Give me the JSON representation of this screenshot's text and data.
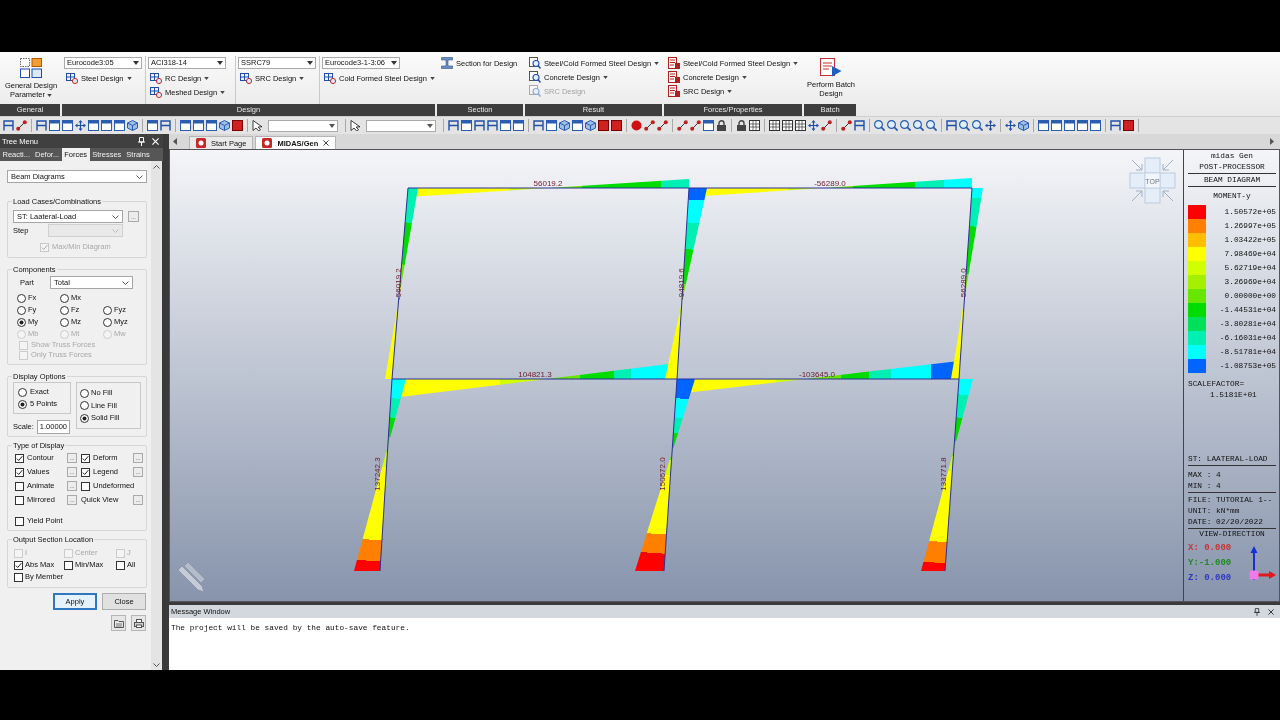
{
  "ribbon": {
    "groups": [
      {
        "label": "General",
        "columns": [
          [
            {
              "kind": "large",
              "label": "General Design Parameter",
              "menu": true,
              "disabled": false
            }
          ]
        ]
      },
      {
        "label": "Design",
        "columns": [
          [
            {
              "kind": "select",
              "label": "Eurocode3:05"
            },
            {
              "kind": "button",
              "label": "Steel Design",
              "menu": true,
              "disabled": false
            }
          ],
          [
            {
              "kind": "select",
              "label": "ACI318-14"
            },
            {
              "kind": "button",
              "label": "RC Design",
              "menu": true,
              "disabled": false
            },
            {
              "kind": "button",
              "label": "Meshed Design",
              "menu": true,
              "disabled": false
            }
          ],
          [
            {
              "kind": "select",
              "label": "SSRC79"
            },
            {
              "kind": "button",
              "label": "SRC Design",
              "menu": true,
              "disabled": false
            }
          ],
          [
            {
              "kind": "select",
              "label": "Eurocode3-1-3:06"
            },
            {
              "kind": "button",
              "label": "Cold Formed Steel Design",
              "menu": true,
              "disabled": false
            }
          ]
        ]
      },
      {
        "label": "Section",
        "columns": [
          [
            {
              "kind": "button",
              "label": "Section for Design",
              "menu": false,
              "disabled": false
            }
          ]
        ]
      },
      {
        "label": "Result",
        "columns": [
          [
            {
              "kind": "button",
              "label": "Steel/Cold Formed Steel Design",
              "menu": true,
              "disabled": false
            },
            {
              "kind": "button",
              "label": "Concrete Design",
              "menu": true,
              "disabled": false
            },
            {
              "kind": "button",
              "label": "SRC Design",
              "menu": false,
              "disabled": true
            }
          ]
        ]
      },
      {
        "label": "Forces/Properties",
        "columns": [
          [
            {
              "kind": "button",
              "label": "Steel/Cold Formed Steel Design",
              "menu": true,
              "disabled": false
            },
            {
              "kind": "button",
              "label": "Concrete Design",
              "menu": true,
              "disabled": false
            },
            {
              "kind": "button",
              "label": "SRC Design",
              "menu": true,
              "disabled": false
            }
          ]
        ]
      },
      {
        "label": "Batch",
        "columns": [
          [
            {
              "kind": "large",
              "label": "Perform Batch Design",
              "menu": false,
              "disabled": false
            }
          ]
        ]
      }
    ]
  },
  "tree_menu": {
    "title": "Tree Menu",
    "tabs": [
      {
        "label": "Reacti...",
        "selected": false
      },
      {
        "label": "Defor...",
        "selected": false
      },
      {
        "label": "Forces",
        "selected": true
      },
      {
        "label": "Stresses",
        "selected": false
      },
      {
        "label": "Strains",
        "selected": false
      }
    ],
    "diagram_type": "Beam Diagrams",
    "load_cases": {
      "title": "Load Cases/Combinations",
      "value": "ST: Laateral-Load",
      "more_button": "...",
      "step_label": "Step",
      "max_min": {
        "label": "Max/Min Diagram",
        "checked": true,
        "disabled": true
      }
    },
    "components": {
      "title": "Components",
      "part_label": "Part",
      "part": "Total",
      "rows": [
        [
          {
            "label": "Fx",
            "selected": false,
            "disabled": false
          },
          {
            "label": "Mx",
            "selected": false,
            "disabled": false
          }
        ],
        [
          {
            "label": "Fy",
            "selected": false,
            "disabled": false
          },
          {
            "label": "Fz",
            "selected": false,
            "disabled": false
          },
          {
            "label": "Fyz",
            "selected": false,
            "disabled": false
          }
        ],
        [
          {
            "label": "My",
            "selected": true,
            "disabled": false
          },
          {
            "label": "Mz",
            "selected": false,
            "disabled": false
          },
          {
            "label": "Myz",
            "selected": false,
            "disabled": false
          }
        ],
        [
          {
            "label": "Mb",
            "selected": false,
            "disabled": true
          },
          {
            "label": "Mt",
            "selected": false,
            "disabled": true
          },
          {
            "label": "Mw",
            "selected": false,
            "disabled": true
          }
        ]
      ],
      "checks": [
        {
          "label": "Show Truss Forces",
          "checked": false,
          "disabled": true
        },
        {
          "label": "Only Truss Forces",
          "checked": false,
          "disabled": true
        }
      ]
    },
    "display_options": {
      "title": "Display Options",
      "points": [
        {
          "label": "Exact",
          "selected": false
        },
        {
          "label": "5 Points",
          "selected": true
        }
      ],
      "fill": [
        {
          "label": "No Fill",
          "selected": false
        },
        {
          "label": "Line Fill",
          "selected": false
        },
        {
          "label": "Solid Fill",
          "selected": true
        }
      ],
      "scale_label": "Scale:",
      "scale": "1.00000"
    },
    "type_of_display": {
      "title": "Type of Display",
      "items": [
        {
          "kind": "check",
          "label": "Contour",
          "checked": true,
          "button": "..."
        },
        {
          "kind": "check",
          "label": "Deform",
          "checked": true,
          "button": "..."
        },
        {
          "kind": "check",
          "label": "Values",
          "checked": true,
          "button": "..."
        },
        {
          "kind": "check",
          "label": "Legend",
          "checked": true,
          "button": "..."
        },
        {
          "kind": "check",
          "label": "Animate",
          "checked": false,
          "button": "..."
        },
        {
          "kind": "check",
          "label": "Undeformed",
          "checked": false
        },
        {
          "kind": "check",
          "label": "Mirrored",
          "checked": false,
          "button": "..."
        },
        {
          "kind": "text",
          "label": "Quick View",
          "button": "..."
        }
      ],
      "yield_point": {
        "label": "Yield Point",
        "checked": false
      }
    },
    "output_location": {
      "title": "Output Section Location",
      "rows": [
        [
          {
            "label": "I",
            "checked": false,
            "disabled": true
          },
          {
            "label": "Center",
            "checked": false,
            "disabled": true
          },
          {
            "label": "J",
            "checked": false,
            "disabled": true
          }
        ],
        [
          {
            "label": "Abs Max",
            "checked": true,
            "disabled": false
          },
          {
            "label": "Min/Max",
            "checked": false,
            "disabled": false
          },
          {
            "label": "All",
            "checked": false,
            "disabled": false
          }
        ],
        [
          {
            "label": "By Member",
            "checked": false,
            "disabled": false
          }
        ]
      ]
    },
    "buttons": [
      {
        "label": "Apply",
        "focused": true
      },
      {
        "label": "Close",
        "focused": false
      }
    ]
  },
  "doc_tabs": [
    {
      "label": "Start Page",
      "selected": false
    },
    {
      "label": "MIDAS/Gen",
      "selected": true
    }
  ],
  "viewport": {
    "view_cube": "TOP",
    "value_labels": [
      "56019.2",
      "-56289.0",
      "-56019.2",
      "-94819.6",
      "-56289.0",
      "104821.3",
      "-103645.0",
      "137242.3",
      "150572.0",
      "133771.8"
    ]
  },
  "legend": {
    "product": "midas Gen",
    "module": "POST-PROCESSOR",
    "diagram": "BEAM DIAGRAM",
    "component": "MOMENT-y",
    "scale": [
      {
        "value": "1.50572e+05",
        "color": "#ff0000"
      },
      {
        "value": "1.26997e+05",
        "color": "#ff7f00"
      },
      {
        "value": "1.03422e+05",
        "color": "#ffbf00"
      },
      {
        "value": "7.98469e+04",
        "color": "#ffff00"
      },
      {
        "value": "5.62719e+04",
        "color": "#d2ff00"
      },
      {
        "value": "3.26969e+04",
        "color": "#a5f000"
      },
      {
        "value": "0.00000e+00",
        "color": "#66e600"
      },
      {
        "value": "-1.44531e+04",
        "color": "#00dc00"
      },
      {
        "value": "-3.80281e+04",
        "color": "#00e05a"
      },
      {
        "value": "-6.16031e+04",
        "color": "#00f0b4"
      },
      {
        "value": "-8.51781e+04",
        "color": "#00ffff"
      },
      {
        "value": "-1.08753e+05",
        "color": "#0064ff"
      }
    ],
    "scale_factor_label": "SCALEFACTOR=",
    "scale_factor": "1.5181E+01",
    "load_case": "ST: LAATERAL-LOAD",
    "max": "MAX : 4",
    "min": "MIN : 4",
    "file": "FILE: TUTORIAL 1--",
    "unit": "UNIT: kN*mm",
    "date": "DATE: 02/20/2022",
    "view_title": "VIEW-DIRECTION",
    "view": [
      {
        "text": "X: 0.000",
        "color": "#c83232"
      },
      {
        "text": "Y:-1.000",
        "color": "#1f8a1f"
      },
      {
        "text": "Z: 0.000",
        "color": "#2f38c0"
      }
    ]
  },
  "message_window": {
    "title": "Message Window",
    "lines": [
      "The project will be saved by the auto-save feature."
    ]
  }
}
